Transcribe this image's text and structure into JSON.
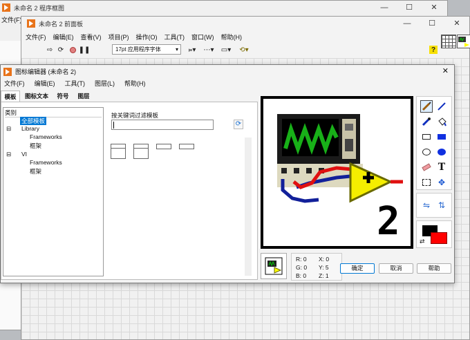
{
  "block_diagram": {
    "title": "未命名 2 程序框图",
    "menu_file": "文件(F)"
  },
  "front_panel": {
    "title": "未命名 2 前面板",
    "menu": [
      "文件(F)",
      "编辑(E)",
      "查看(V)",
      "项目(P)",
      "操作(O)",
      "工具(T)",
      "窗口(W)",
      "帮助(H)"
    ],
    "font": "17pt 应用程序字体",
    "help_icon": "?"
  },
  "icon_editor": {
    "title": "图标编辑器 (未命名 2)",
    "menu": [
      "文件(F)",
      "编辑(E)",
      "工具(T)",
      "图层(L)",
      "帮助(H)"
    ],
    "tabs": [
      "模板",
      "图标文本",
      "符号",
      "图层"
    ],
    "tree": {
      "header": "类别",
      "all": "全部模板",
      "library": "Library",
      "library_children": [
        "Frameworks",
        "框架"
      ],
      "vi": "VI",
      "vi_children": [
        "Frameworks",
        "框架"
      ]
    },
    "filter_label": "按关键词过滤模板",
    "filter_value": "",
    "canvas_number": "2",
    "coords": {
      "r": "R: 0",
      "g": "G: 0",
      "b": "B: 0",
      "x": "X: 0",
      "y": "Y: 5",
      "z": "Z: 1"
    },
    "buttons": {
      "ok": "确定",
      "cancel": "取消",
      "help": "帮助"
    },
    "colors": {
      "foreground": "#000000",
      "background": "#ff0000",
      "selection": "#0078d4"
    }
  }
}
